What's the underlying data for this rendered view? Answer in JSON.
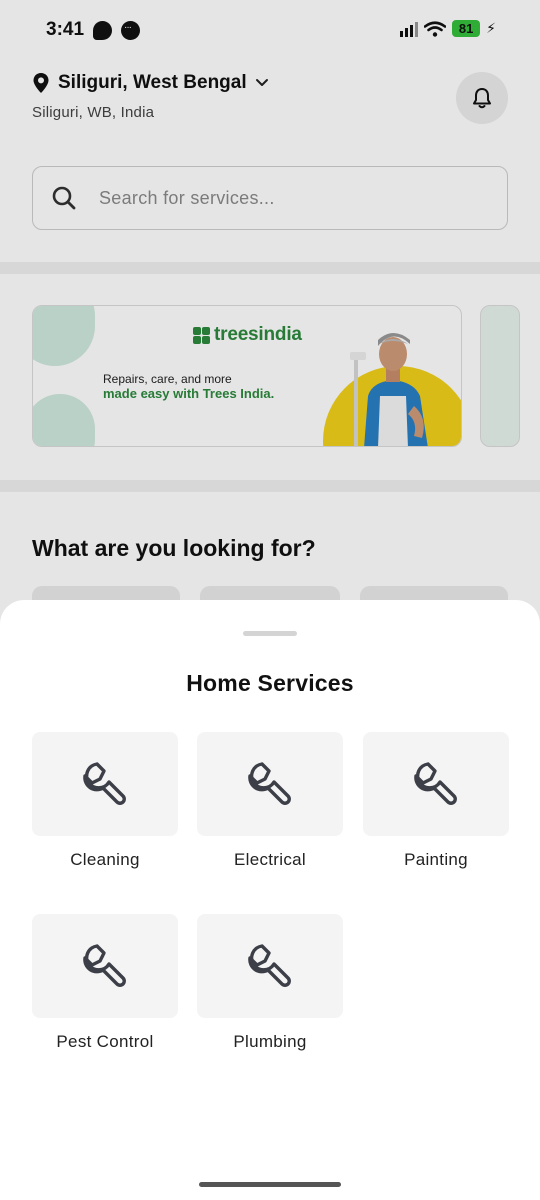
{
  "status_bar": {
    "time": "3:41",
    "battery_level": "81",
    "battery_color": "#34c03c"
  },
  "header": {
    "location_title": "Siliguri, West Bengal",
    "location_subtitle": "Siliguri, WB, India",
    "location_icon": "map-pin-icon",
    "dropdown_icon": "chevron-down-icon",
    "notification_icon": "bell-icon"
  },
  "search": {
    "placeholder": "Search for services...",
    "icon": "search-icon"
  },
  "banner": {
    "brand": "treesindia",
    "line1": "Repairs, care, and more",
    "line2": "made easy with Trees India.",
    "brand_color": "#2d8a3e",
    "accent_color": "#f2d11b"
  },
  "section": {
    "title": "What are you looking for?"
  },
  "sheet": {
    "title": "Home Services",
    "services": [
      {
        "label": "Cleaning",
        "icon": "wrench-icon"
      },
      {
        "label": "Electrical",
        "icon": "wrench-icon"
      },
      {
        "label": "Painting",
        "icon": "wrench-icon"
      },
      {
        "label": "Pest Control",
        "icon": "wrench-icon"
      },
      {
        "label": "Plumbing",
        "icon": "wrench-icon"
      }
    ]
  }
}
